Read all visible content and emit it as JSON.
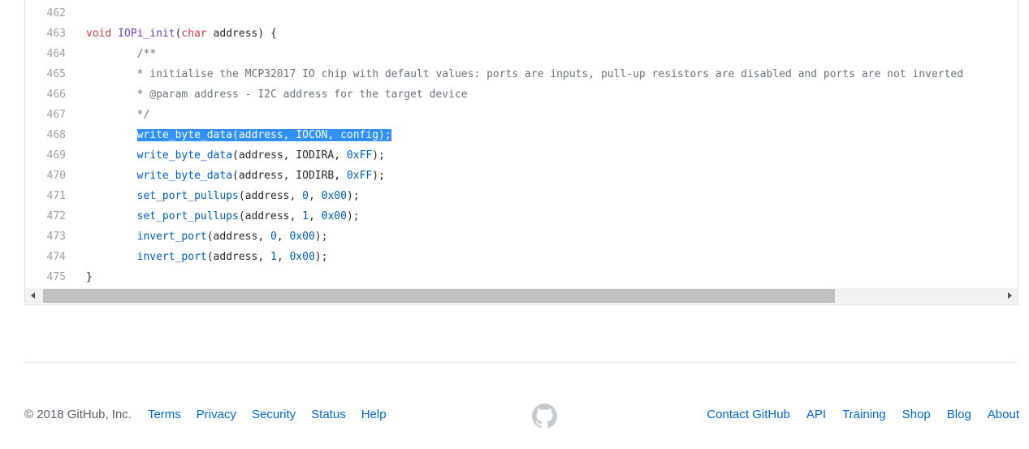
{
  "code": {
    "lines": [
      {
        "num": "462",
        "tokens": []
      },
      {
        "num": "463",
        "tokens": [
          {
            "t": "void ",
            "c": "kw"
          },
          {
            "t": "IOPi_init",
            "c": "fn"
          },
          {
            "t": "(",
            "c": ""
          },
          {
            "t": "char",
            "c": "kw"
          },
          {
            "t": " address) {",
            "c": ""
          }
        ]
      },
      {
        "num": "464",
        "tokens": [
          {
            "t": "        /**",
            "c": "cm"
          }
        ]
      },
      {
        "num": "465",
        "tokens": [
          {
            "t": "        * initialise the MCP32017 IO chip with default values: ports are inputs, pull-up resistors are disabled and ports are not inverted",
            "c": "cm"
          }
        ]
      },
      {
        "num": "466",
        "tokens": [
          {
            "t": "        * @param address - I2C address for the target device",
            "c": "cm"
          }
        ]
      },
      {
        "num": "467",
        "tokens": [
          {
            "t": "        */",
            "c": "cm"
          }
        ]
      },
      {
        "num": "468",
        "selected": true,
        "tokens": [
          {
            "t": "        ",
            "c": ""
          },
          {
            "t": "write_byte_data(address, IOCON, config);",
            "c": "sel"
          }
        ]
      },
      {
        "num": "469",
        "tokens": [
          {
            "t": "        ",
            "c": ""
          },
          {
            "t": "write_byte_data",
            "c": "call"
          },
          {
            "t": "(address, IODIRA, ",
            "c": ""
          },
          {
            "t": "0xFF",
            "c": "num"
          },
          {
            "t": ");",
            "c": ""
          }
        ]
      },
      {
        "num": "470",
        "tokens": [
          {
            "t": "        ",
            "c": ""
          },
          {
            "t": "write_byte_data",
            "c": "call"
          },
          {
            "t": "(address, IODIRB, ",
            "c": ""
          },
          {
            "t": "0xFF",
            "c": "num"
          },
          {
            "t": ");",
            "c": ""
          }
        ]
      },
      {
        "num": "471",
        "tokens": [
          {
            "t": "        ",
            "c": ""
          },
          {
            "t": "set_port_pullups",
            "c": "call"
          },
          {
            "t": "(address, ",
            "c": ""
          },
          {
            "t": "0",
            "c": "num"
          },
          {
            "t": ", ",
            "c": ""
          },
          {
            "t": "0x00",
            "c": "num"
          },
          {
            "t": ");",
            "c": ""
          }
        ]
      },
      {
        "num": "472",
        "tokens": [
          {
            "t": "        ",
            "c": ""
          },
          {
            "t": "set_port_pullups",
            "c": "call"
          },
          {
            "t": "(address, ",
            "c": ""
          },
          {
            "t": "1",
            "c": "num"
          },
          {
            "t": ", ",
            "c": ""
          },
          {
            "t": "0x00",
            "c": "num"
          },
          {
            "t": ");",
            "c": ""
          }
        ]
      },
      {
        "num": "473",
        "tokens": [
          {
            "t": "        ",
            "c": ""
          },
          {
            "t": "invert_port",
            "c": "call"
          },
          {
            "t": "(address, ",
            "c": ""
          },
          {
            "t": "0",
            "c": "num"
          },
          {
            "t": ", ",
            "c": ""
          },
          {
            "t": "0x00",
            "c": "num"
          },
          {
            "t": ");",
            "c": ""
          }
        ]
      },
      {
        "num": "474",
        "tokens": [
          {
            "t": "        ",
            "c": ""
          },
          {
            "t": "invert_port",
            "c": "call"
          },
          {
            "t": "(address, ",
            "c": ""
          },
          {
            "t": "1",
            "c": "num"
          },
          {
            "t": ", ",
            "c": ""
          },
          {
            "t": "0x00",
            "c": "num"
          },
          {
            "t": ");",
            "c": ""
          }
        ]
      },
      {
        "num": "475",
        "tokens": [
          {
            "t": "}",
            "c": ""
          }
        ]
      }
    ]
  },
  "footer": {
    "copyright": "© 2018 GitHub, Inc.",
    "left_links": [
      {
        "name": "footer-link-terms",
        "label": "Terms"
      },
      {
        "name": "footer-link-privacy",
        "label": "Privacy"
      },
      {
        "name": "footer-link-security",
        "label": "Security"
      },
      {
        "name": "footer-link-status",
        "label": "Status"
      },
      {
        "name": "footer-link-help",
        "label": "Help"
      }
    ],
    "right_links": [
      {
        "name": "footer-link-contact-github",
        "label": "Contact GitHub"
      },
      {
        "name": "footer-link-api",
        "label": "API"
      },
      {
        "name": "footer-link-training",
        "label": "Training"
      },
      {
        "name": "footer-link-shop",
        "label": "Shop"
      },
      {
        "name": "footer-link-blog",
        "label": "Blog"
      },
      {
        "name": "footer-link-about",
        "label": "About"
      }
    ],
    "logo_icon": "github-octocat-icon"
  },
  "colors": {
    "link": "#0366d6",
    "selection": "#3390ff",
    "keyword": "#d73a49",
    "function_name": "#6f42c1",
    "constant": "#005cc5",
    "comment": "#6a737d"
  }
}
